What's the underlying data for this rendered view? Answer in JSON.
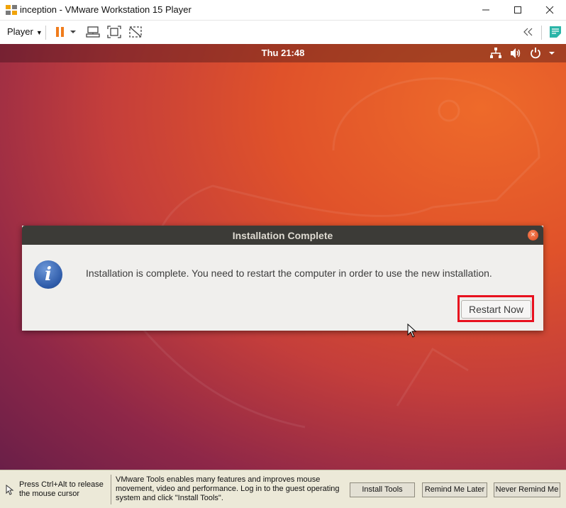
{
  "window": {
    "title": "inception - VMware Workstation 15 Player",
    "controls": [
      "minimize",
      "maximize",
      "close"
    ]
  },
  "toolbar": {
    "player_label": "Player",
    "icons": [
      "pause-icon",
      "send-ctrl-alt-del-icon",
      "fullscreen-icon",
      "unity-icon",
      "collapse-icon",
      "notes-icon"
    ]
  },
  "guest": {
    "clock": "Thu 21:48",
    "tray_icons": [
      "network-icon",
      "volume-icon",
      "power-icon",
      "menu-caret-icon"
    ]
  },
  "dialog": {
    "title": "Installation Complete",
    "message": "Installation is complete. You need to restart the computer in order to use the new installation.",
    "restart_button": "Restart Now",
    "highlight_color": "#e8101e"
  },
  "bottombar": {
    "hint": "Press Ctrl+Alt to release the mouse cursor",
    "tools_message": "VMware Tools enables many features and improves mouse movement, video and performance. Log in to the guest operating system and click \"Install Tools\".",
    "install_tools": "Install Tools",
    "remind_later": "Remind Me Later",
    "never_remind": "Never Remind Me"
  }
}
